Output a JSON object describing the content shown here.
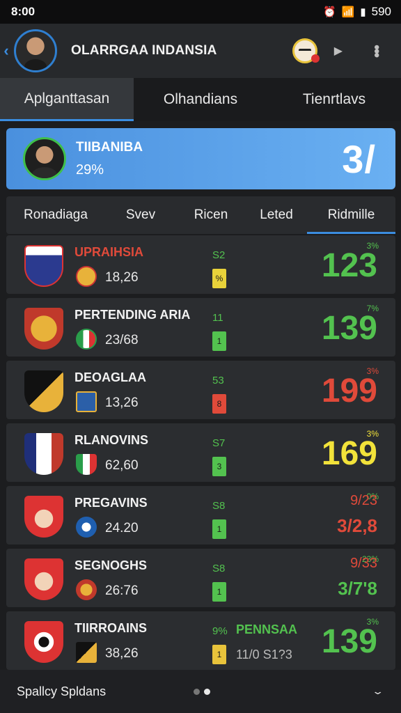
{
  "status_bar": {
    "time": "8:00",
    "battery": "590",
    "icons": [
      "alarm-icon",
      "wifi-icon",
      "signal-icon",
      "battery-icon"
    ]
  },
  "header": {
    "title": "OLARRGAA INDANSIA"
  },
  "tabs": [
    {
      "label": "Aplganttasan",
      "active": true
    },
    {
      "label": "Olhandians",
      "active": false
    },
    {
      "label": "Tienrtlavs",
      "active": false
    }
  ],
  "featured": {
    "name": "TIIBANIBA",
    "percent": "29%",
    "score": "3/"
  },
  "columns": [
    "Ronadiaga",
    "Svev",
    "Ricen",
    "Leted",
    "Ridmille"
  ],
  "rows": [
    {
      "name": "UPRAIHSIA",
      "sub": "18,26",
      "small": "S2",
      "chip": "%",
      "corner": "3%",
      "big": "123",
      "name_color": "#e04a3a",
      "small_color": "#53c24f",
      "chip_color": "#e8d23a",
      "big_color": "#53c24f"
    },
    {
      "name": "PERTENDING ARIA",
      "sub": "23/68",
      "small": "11",
      "chip": "1",
      "corner": "7%",
      "big": "139",
      "name_color": "#f2f2f2",
      "small_color": "#53c24f",
      "chip_color": "#53c24f",
      "big_color": "#53c24f"
    },
    {
      "name": "DEOAGLAA",
      "sub": "13,26",
      "small": "53",
      "chip": "8",
      "corner": "3%",
      "big": "199",
      "name_color": "#f2f2f2",
      "small_color": "#53c24f",
      "chip_color": "#e04a3a",
      "big_color": "#e04a3a"
    },
    {
      "name": "RLANOVINS",
      "sub": "62,60",
      "small": "S7",
      "chip": "3",
      "corner": "3%",
      "big": "169",
      "name_color": "#f2f2f2",
      "small_color": "#53c24f",
      "chip_color": "#53c24f",
      "big_color": "#f2e23a"
    },
    {
      "name": "PREGAVINS",
      "sub": "24.20",
      "small": "S8",
      "chip": "1",
      "corner": "0%",
      "alt": "9/23",
      "big": "3/2,8",
      "name_color": "#f2f2f2",
      "small_color": "#53c24f",
      "chip_color": "#53c24f",
      "big_color": "#e04a3a",
      "alt_color": "#e04a3a"
    },
    {
      "name": "SEGNOGHS",
      "sub": "26:76",
      "small": "S8",
      "chip": "1",
      "corner": "23%",
      "alt": "9/33",
      "big": "3/7'8",
      "name_color": "#f2f2f2",
      "small_color": "#53c24f",
      "chip_color": "#53c24f",
      "big_color": "#53c24f",
      "alt_color": "#e04a3a"
    },
    {
      "name": "TIIRROAINS",
      "sub": "38,26",
      "small": "9%",
      "chip": "1",
      "mid_top": "PENNSAA",
      "mid": "11/0 S1?3",
      "corner": "3%",
      "big": "139",
      "name_color": "#f2f2f2",
      "small_color": "#53c24f",
      "chip_color": "#e8c33b",
      "big_color": "#53c24f"
    }
  ],
  "footer": {
    "label": "Spallcy Spldans"
  },
  "colors": {
    "accent": "#3b8de0",
    "green": "#53c24f",
    "red": "#e04a3a",
    "yellow": "#f2e23a"
  }
}
